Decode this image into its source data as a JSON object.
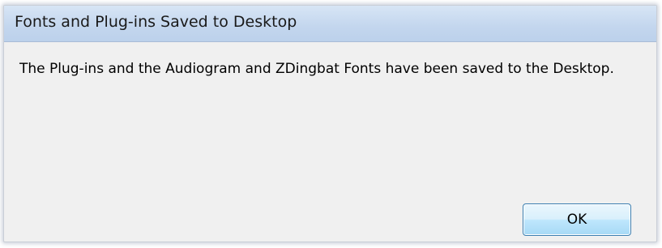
{
  "dialog": {
    "title": "Fonts and Plug-ins Saved to Desktop",
    "message": "The Plug-ins and the Audiogram and ZDingbat Fonts have been saved to the Desktop.",
    "ok_label": "OK"
  },
  "colors": {
    "titlebar": "#c3d6ee",
    "dialog_background": "#f0f0f0",
    "button_border": "#3c7fb1"
  }
}
